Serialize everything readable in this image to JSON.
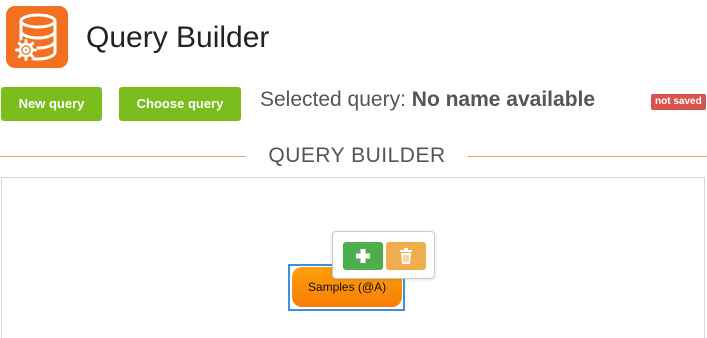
{
  "header": {
    "app_icon": "database-gear-icon",
    "title": "Query Builder"
  },
  "toolbar": {
    "new_query_label": "New query",
    "choose_query_label": "Choose query",
    "selected_query_prefix": "Selected query:",
    "selected_query_name": "No name available",
    "status_badge": "not saved"
  },
  "section": {
    "title": "QUERY BUILDER"
  },
  "canvas": {
    "node_label": "Samples (@A)",
    "node_selected": true,
    "popover": {
      "add_icon": "plus-icon",
      "delete_icon": "trash-icon"
    }
  },
  "colors": {
    "brand_orange": "#f36f21",
    "button_green": "#7cbd1e",
    "badge_red": "#d9534f",
    "node_orange": "#f88a0a",
    "selection_blue": "#3d8fe0",
    "add_green": "#4cae4c",
    "delete_amber": "#f0ad4e"
  }
}
